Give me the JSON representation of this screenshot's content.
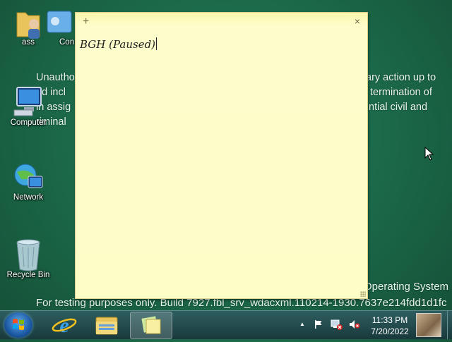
{
  "wallpaper": {
    "left_lines": [
      "Unautho",
      "nd incl",
      "in assig",
      "riminal"
    ],
    "right_lines": [
      "ary action up to",
      "termination of",
      "ntial civil and",
      ""
    ],
    "os_line": "Operating System",
    "build_line": "For testing purposes only. Build 7927.fbl_srv_wdacxml.110214-1930.7637e214fdd1d1fc"
  },
  "desktop_icons": {
    "ass": "ass",
    "control": "Con",
    "computer": "Computer",
    "network": "Network",
    "recycle": "Recycle Bin"
  },
  "note": {
    "add_glyph": "+",
    "close_glyph": "×",
    "text": "BGH (Paused)"
  },
  "taskbar": {
    "time": "11:33 PM",
    "date": "7/20/2022",
    "tray_chevron": "▲"
  },
  "colors": {
    "wallpaper": "#1e6b4a",
    "note": "#fdfdc6",
    "taskbar": "#19393c"
  }
}
